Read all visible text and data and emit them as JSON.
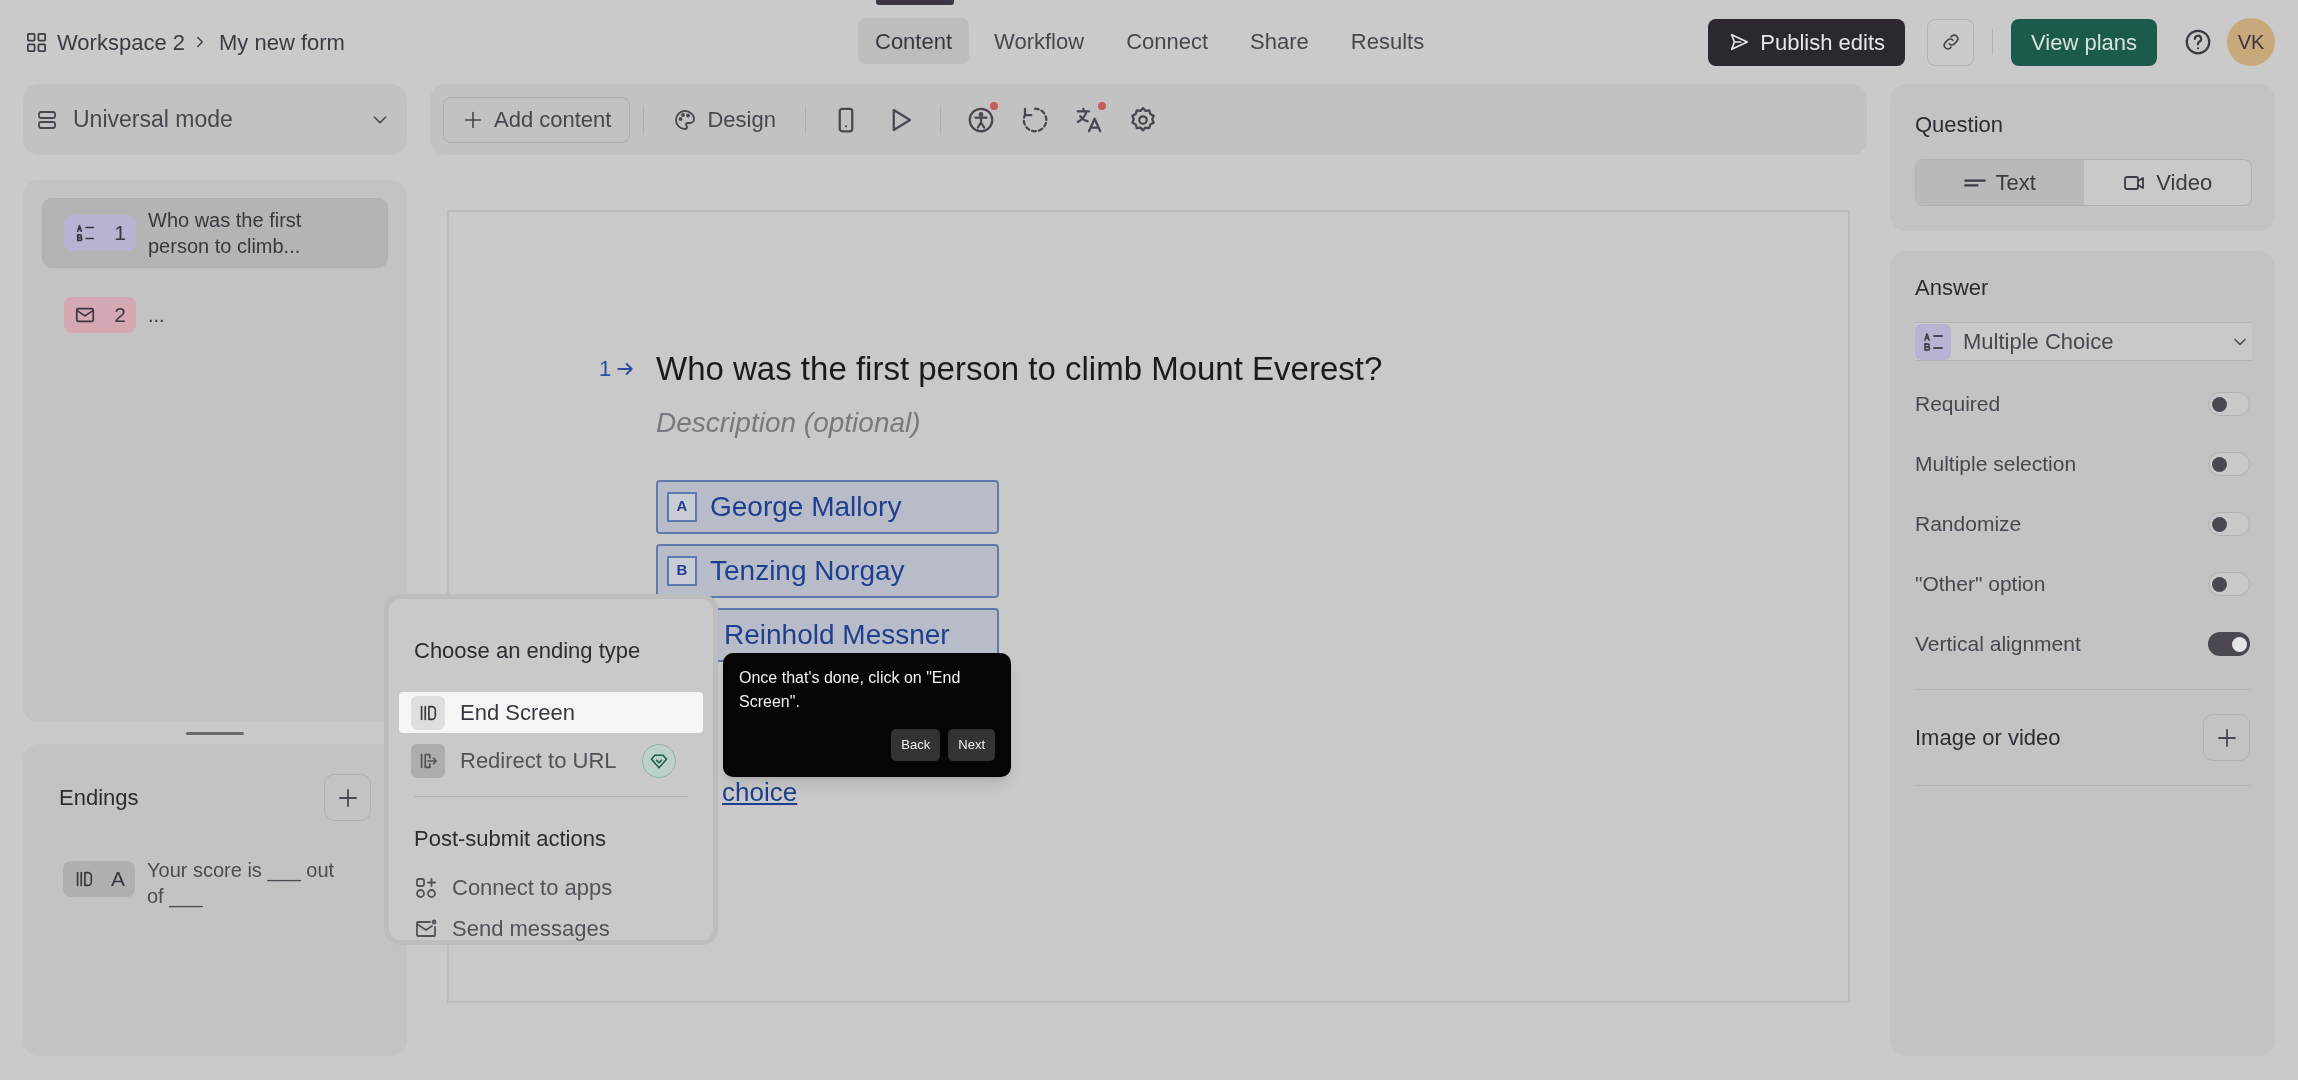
{
  "breadcrumb": {
    "workspace": "Workspace 2",
    "form": "My new form"
  },
  "nav_tabs": [
    {
      "label": "Content",
      "selected": true
    },
    {
      "label": "Workflow",
      "selected": false
    },
    {
      "label": "Connect",
      "selected": false
    },
    {
      "label": "Share",
      "selected": false
    },
    {
      "label": "Results",
      "selected": false
    }
  ],
  "publish_button": "Publish edits",
  "plans_button": "View plans",
  "avatar": "VK",
  "mode_selector": "Universal mode",
  "toolbar": {
    "add_content": "Add content",
    "design": "Design",
    "tools": [
      {
        "kind": "phone",
        "badge": false
      },
      {
        "kind": "play",
        "badge": false
      },
      {
        "kind": "accessibility",
        "badge": true
      },
      {
        "kind": "loop",
        "badge": false
      },
      {
        "kind": "translate",
        "badge": true
      },
      {
        "kind": "settings",
        "badge": false
      }
    ]
  },
  "questions": [
    {
      "number": "1",
      "text": "Who was the first person to climb...",
      "kind": "choice",
      "color": "#b8b3d2",
      "selected": true
    },
    {
      "number": "2",
      "text": "...",
      "kind": "email",
      "color": "#d4a9b3",
      "selected": false
    }
  ],
  "endings": {
    "title": "Endings",
    "items": [
      {
        "letter": "A",
        "text": "Your score is ___ out of ___"
      }
    ]
  },
  "question_editor": {
    "number": "1",
    "title": "Who was the first person to climb Mount Everest?",
    "description_placeholder": "Description (optional)",
    "choices": [
      {
        "key": "A",
        "label": "George Mallory"
      },
      {
        "key": "B",
        "label": "Tenzing Norgay"
      },
      {
        "label": "Reinhold Messner"
      }
    ],
    "add_choice": "choice"
  },
  "ending_menu": {
    "title": "Choose an ending type",
    "options": [
      {
        "kind": "end-screen",
        "label": "End Screen",
        "selected": true,
        "premium": false
      },
      {
        "kind": "redirect",
        "label": "Redirect to URL",
        "selected": false,
        "premium": true
      }
    ],
    "section": "Post-submit actions",
    "actions": [
      {
        "kind": "apps",
        "label": "Connect to apps"
      },
      {
        "kind": "messages",
        "label": "Send messages"
      }
    ]
  },
  "tooltip": {
    "text": "Once that's done, click on \"End Screen\".",
    "buttons": [
      "Back",
      "Next"
    ]
  },
  "question_panel": {
    "title": "Question",
    "modes": [
      {
        "kind": "text",
        "label": "Text",
        "selected": true
      },
      {
        "kind": "video",
        "label": "Video",
        "selected": false
      }
    ]
  },
  "answer_panel": {
    "title": "Answer",
    "type": "Multiple Choice",
    "settings": [
      {
        "label": "Required",
        "on": false
      },
      {
        "label": "Multiple selection",
        "on": false
      },
      {
        "label": "Randomize",
        "on": false
      },
      {
        "label": "\"Other\" option",
        "on": false
      },
      {
        "label": "Vertical alignment",
        "on": true
      }
    ],
    "media_label": "Image or video"
  }
}
